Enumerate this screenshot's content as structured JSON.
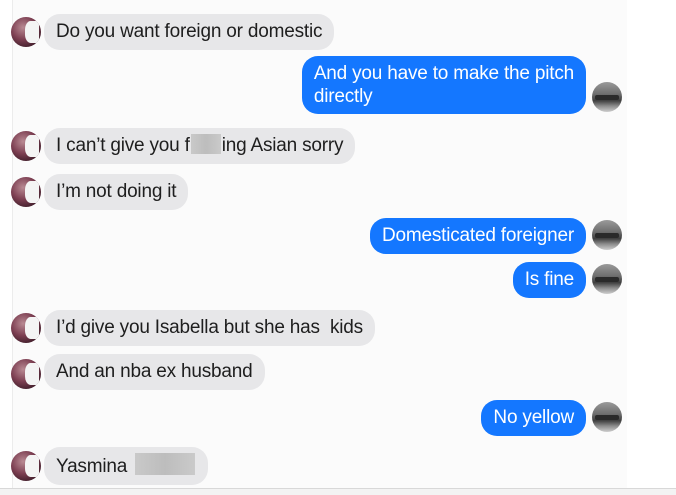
{
  "messages": [
    {
      "side": "in",
      "text": "Do you want foreign or domestic"
    },
    {
      "side": "out",
      "line1": "And you have to make the pitch",
      "line2": "directly"
    },
    {
      "side": "in",
      "pre": "I can’t give you f",
      "post": "ing Asian sorry"
    },
    {
      "side": "in",
      "text": "I’m not doing it"
    },
    {
      "side": "out",
      "text": "Domesticated foreigner"
    },
    {
      "side": "out",
      "text": "Is fine"
    },
    {
      "side": "in",
      "text": "I’d give you Isabella but she has  kids"
    },
    {
      "side": "in",
      "text": "And an nba ex husband"
    },
    {
      "side": "out",
      "text": "No yellow"
    },
    {
      "side": "in",
      "text": "Yasmina"
    }
  ],
  "colors": {
    "incoming_bubble": "#e7e7e9",
    "outgoing_bubble": "#1477ff"
  },
  "icons": {
    "contact_avatar": "contact-avatar-icon",
    "user_avatar": "user-avatar-icon"
  }
}
